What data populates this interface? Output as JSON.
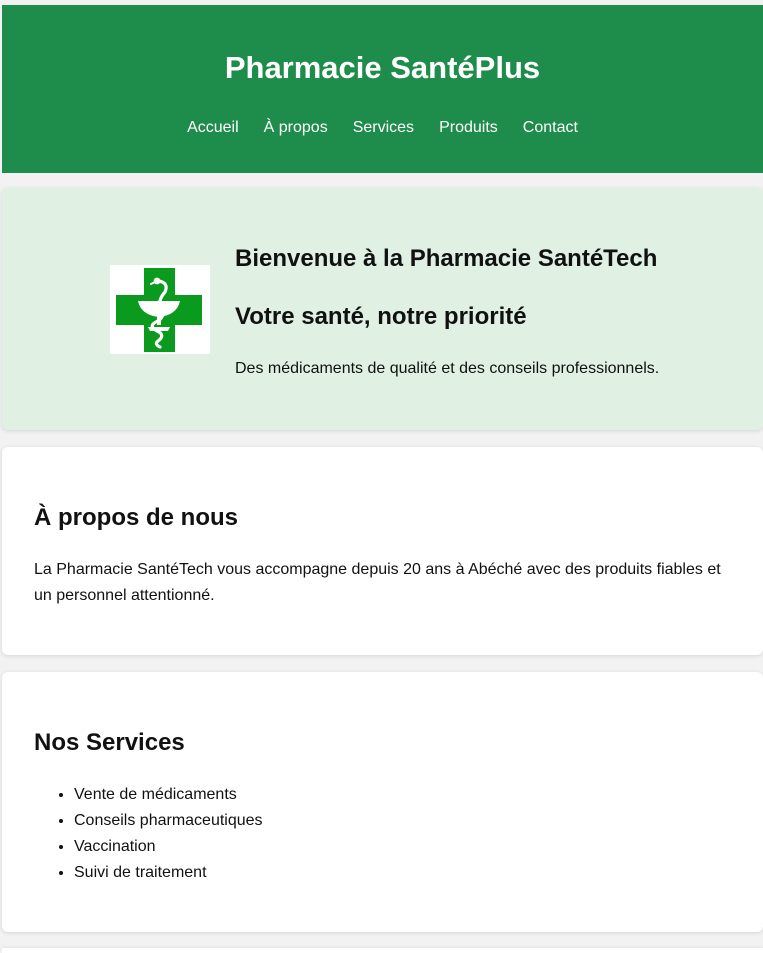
{
  "header": {
    "title": "Pharmacie SantéPlus",
    "nav": [
      "Accueil",
      "À propos",
      "Services",
      "Produits",
      "Contact"
    ],
    "color": "#1e8c4a"
  },
  "hero": {
    "logo_icon": "pharmacy-cross-caduceus-icon",
    "logo_color": "#0a9a1e",
    "title": "Bienvenue à la Pharmacie SantéTech",
    "subtitle": "Votre santé, notre priorité",
    "text": "Des médicaments de qualité et des conseils professionnels.",
    "background": "#e0f1e3"
  },
  "about": {
    "title": "À propos de nous",
    "text": "La Pharmacie SantéTech vous accompagne depuis 20 ans à Abéché avec des produits fiables et un personnel attentionné."
  },
  "services": {
    "title": "Nos Services",
    "items": [
      "Vente de médicaments",
      "Conseils pharmaceutiques",
      "Vaccination",
      "Suivi de traitement"
    ]
  }
}
